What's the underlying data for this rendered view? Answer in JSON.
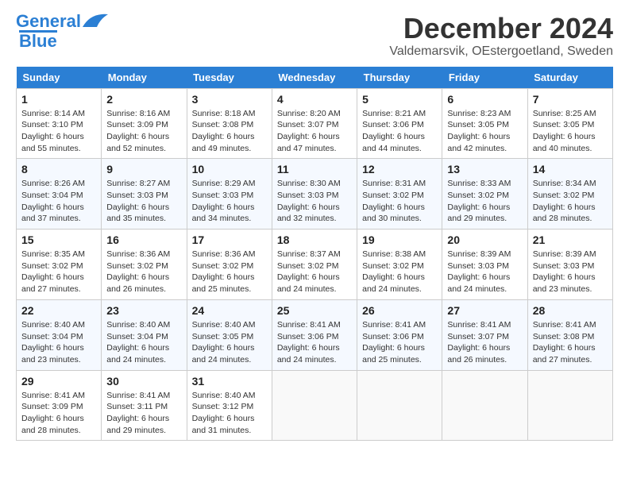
{
  "header": {
    "logo_line1": "General",
    "logo_line2": "Blue",
    "title": "December 2024",
    "subtitle": "Valdemarsvik, OEstergoetland, Sweden"
  },
  "columns": [
    "Sunday",
    "Monday",
    "Tuesday",
    "Wednesday",
    "Thursday",
    "Friday",
    "Saturday"
  ],
  "weeks": [
    [
      {
        "day": "1",
        "sunrise": "Sunrise: 8:14 AM",
        "sunset": "Sunset: 3:10 PM",
        "daylight": "Daylight: 6 hours and 55 minutes."
      },
      {
        "day": "2",
        "sunrise": "Sunrise: 8:16 AM",
        "sunset": "Sunset: 3:09 PM",
        "daylight": "Daylight: 6 hours and 52 minutes."
      },
      {
        "day": "3",
        "sunrise": "Sunrise: 8:18 AM",
        "sunset": "Sunset: 3:08 PM",
        "daylight": "Daylight: 6 hours and 49 minutes."
      },
      {
        "day": "4",
        "sunrise": "Sunrise: 8:20 AM",
        "sunset": "Sunset: 3:07 PM",
        "daylight": "Daylight: 6 hours and 47 minutes."
      },
      {
        "day": "5",
        "sunrise": "Sunrise: 8:21 AM",
        "sunset": "Sunset: 3:06 PM",
        "daylight": "Daylight: 6 hours and 44 minutes."
      },
      {
        "day": "6",
        "sunrise": "Sunrise: 8:23 AM",
        "sunset": "Sunset: 3:05 PM",
        "daylight": "Daylight: 6 hours and 42 minutes."
      },
      {
        "day": "7",
        "sunrise": "Sunrise: 8:25 AM",
        "sunset": "Sunset: 3:05 PM",
        "daylight": "Daylight: 6 hours and 40 minutes."
      }
    ],
    [
      {
        "day": "8",
        "sunrise": "Sunrise: 8:26 AM",
        "sunset": "Sunset: 3:04 PM",
        "daylight": "Daylight: 6 hours and 37 minutes."
      },
      {
        "day": "9",
        "sunrise": "Sunrise: 8:27 AM",
        "sunset": "Sunset: 3:03 PM",
        "daylight": "Daylight: 6 hours and 35 minutes."
      },
      {
        "day": "10",
        "sunrise": "Sunrise: 8:29 AM",
        "sunset": "Sunset: 3:03 PM",
        "daylight": "Daylight: 6 hours and 34 minutes."
      },
      {
        "day": "11",
        "sunrise": "Sunrise: 8:30 AM",
        "sunset": "Sunset: 3:03 PM",
        "daylight": "Daylight: 6 hours and 32 minutes."
      },
      {
        "day": "12",
        "sunrise": "Sunrise: 8:31 AM",
        "sunset": "Sunset: 3:02 PM",
        "daylight": "Daylight: 6 hours and 30 minutes."
      },
      {
        "day": "13",
        "sunrise": "Sunrise: 8:33 AM",
        "sunset": "Sunset: 3:02 PM",
        "daylight": "Daylight: 6 hours and 29 minutes."
      },
      {
        "day": "14",
        "sunrise": "Sunrise: 8:34 AM",
        "sunset": "Sunset: 3:02 PM",
        "daylight": "Daylight: 6 hours and 28 minutes."
      }
    ],
    [
      {
        "day": "15",
        "sunrise": "Sunrise: 8:35 AM",
        "sunset": "Sunset: 3:02 PM",
        "daylight": "Daylight: 6 hours and 27 minutes."
      },
      {
        "day": "16",
        "sunrise": "Sunrise: 8:36 AM",
        "sunset": "Sunset: 3:02 PM",
        "daylight": "Daylight: 6 hours and 26 minutes."
      },
      {
        "day": "17",
        "sunrise": "Sunrise: 8:36 AM",
        "sunset": "Sunset: 3:02 PM",
        "daylight": "Daylight: 6 hours and 25 minutes."
      },
      {
        "day": "18",
        "sunrise": "Sunrise: 8:37 AM",
        "sunset": "Sunset: 3:02 PM",
        "daylight": "Daylight: 6 hours and 24 minutes."
      },
      {
        "day": "19",
        "sunrise": "Sunrise: 8:38 AM",
        "sunset": "Sunset: 3:02 PM",
        "daylight": "Daylight: 6 hours and 24 minutes."
      },
      {
        "day": "20",
        "sunrise": "Sunrise: 8:39 AM",
        "sunset": "Sunset: 3:03 PM",
        "daylight": "Daylight: 6 hours and 24 minutes."
      },
      {
        "day": "21",
        "sunrise": "Sunrise: 8:39 AM",
        "sunset": "Sunset: 3:03 PM",
        "daylight": "Daylight: 6 hours and 23 minutes."
      }
    ],
    [
      {
        "day": "22",
        "sunrise": "Sunrise: 8:40 AM",
        "sunset": "Sunset: 3:04 PM",
        "daylight": "Daylight: 6 hours and 23 minutes."
      },
      {
        "day": "23",
        "sunrise": "Sunrise: 8:40 AM",
        "sunset": "Sunset: 3:04 PM",
        "daylight": "Daylight: 6 hours and 24 minutes."
      },
      {
        "day": "24",
        "sunrise": "Sunrise: 8:40 AM",
        "sunset": "Sunset: 3:05 PM",
        "daylight": "Daylight: 6 hours and 24 minutes."
      },
      {
        "day": "25",
        "sunrise": "Sunrise: 8:41 AM",
        "sunset": "Sunset: 3:06 PM",
        "daylight": "Daylight: 6 hours and 24 minutes."
      },
      {
        "day": "26",
        "sunrise": "Sunrise: 8:41 AM",
        "sunset": "Sunset: 3:06 PM",
        "daylight": "Daylight: 6 hours and 25 minutes."
      },
      {
        "day": "27",
        "sunrise": "Sunrise: 8:41 AM",
        "sunset": "Sunset: 3:07 PM",
        "daylight": "Daylight: 6 hours and 26 minutes."
      },
      {
        "day": "28",
        "sunrise": "Sunrise: 8:41 AM",
        "sunset": "Sunset: 3:08 PM",
        "daylight": "Daylight: 6 hours and 27 minutes."
      }
    ],
    [
      {
        "day": "29",
        "sunrise": "Sunrise: 8:41 AM",
        "sunset": "Sunset: 3:09 PM",
        "daylight": "Daylight: 6 hours and 28 minutes."
      },
      {
        "day": "30",
        "sunrise": "Sunrise: 8:41 AM",
        "sunset": "Sunset: 3:11 PM",
        "daylight": "Daylight: 6 hours and 29 minutes."
      },
      {
        "day": "31",
        "sunrise": "Sunrise: 8:40 AM",
        "sunset": "Sunset: 3:12 PM",
        "daylight": "Daylight: 6 hours and 31 minutes."
      },
      null,
      null,
      null,
      null
    ]
  ]
}
